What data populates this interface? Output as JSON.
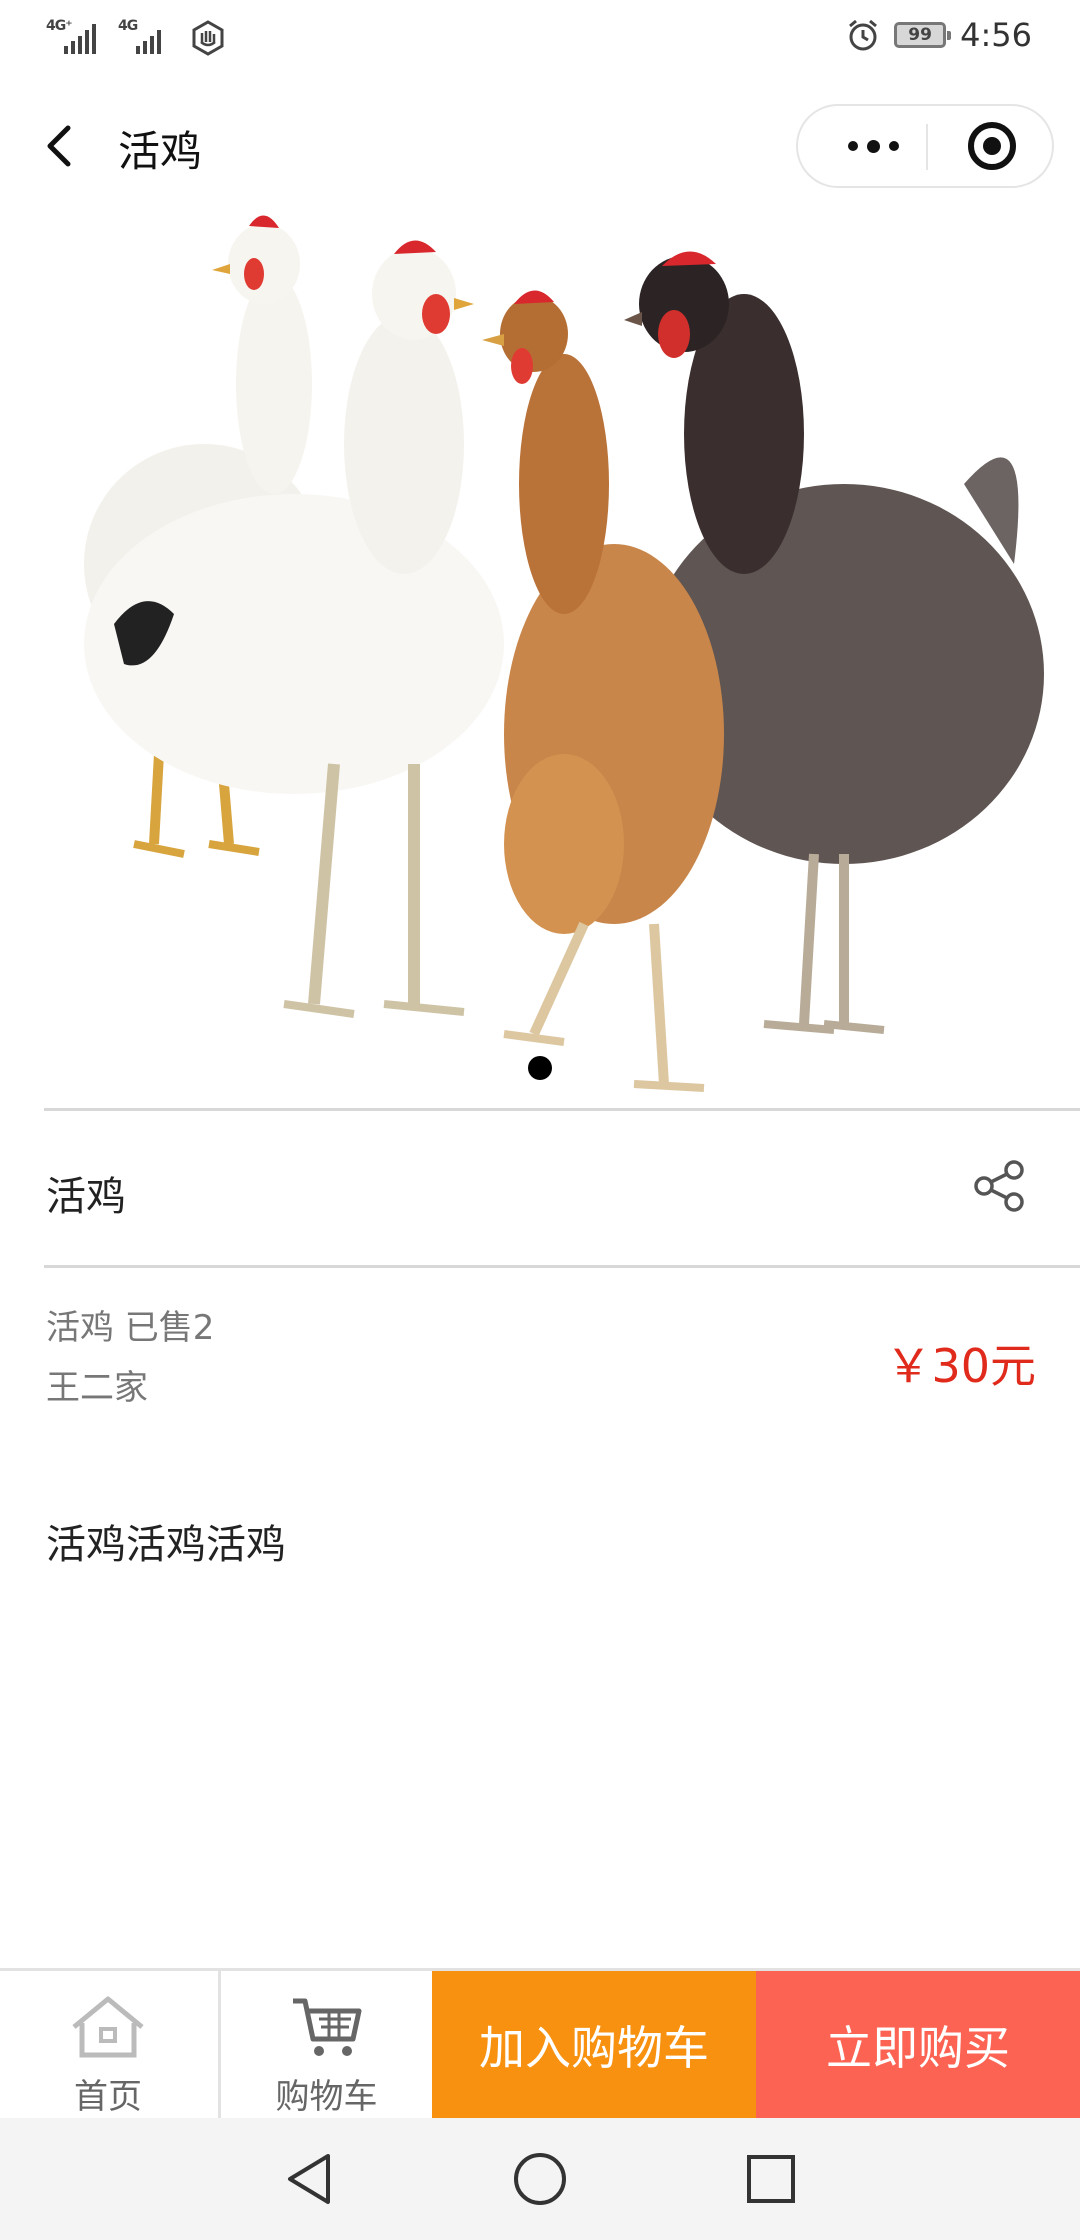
{
  "status_bar": {
    "network1": "4G⁺",
    "network2": "4G",
    "battery": "99",
    "time": "4:56",
    "icons": [
      "signal-icon",
      "signal-icon",
      "hand-icon",
      "alarm-icon",
      "battery-icon"
    ]
  },
  "nav": {
    "title": "活鸡",
    "back_icon": "chevron-left-icon",
    "more_icon": "more-dots-icon",
    "close_icon": "target-close-icon"
  },
  "gallery": {
    "image": "chickens-photo",
    "current_index": 1,
    "total": 1
  },
  "product": {
    "name": "活鸡",
    "share_icon": "share-icon",
    "info_line1": "活鸡 已售2",
    "info_line2": "王二家",
    "price": "￥30元",
    "description": "活鸡活鸡活鸡"
  },
  "bottom_bar": {
    "home_label": "首页",
    "cart_label": "购物车",
    "add_to_cart": "加入购物车",
    "buy_now": "立即购买",
    "colors": {
      "add_to_cart": "#f7910f",
      "buy_now": "#fc6352",
      "price": "#e02b1c"
    }
  },
  "system_nav": {
    "back": "triangle-back-icon",
    "home": "circle-home-icon",
    "recents": "square-recents-icon"
  }
}
